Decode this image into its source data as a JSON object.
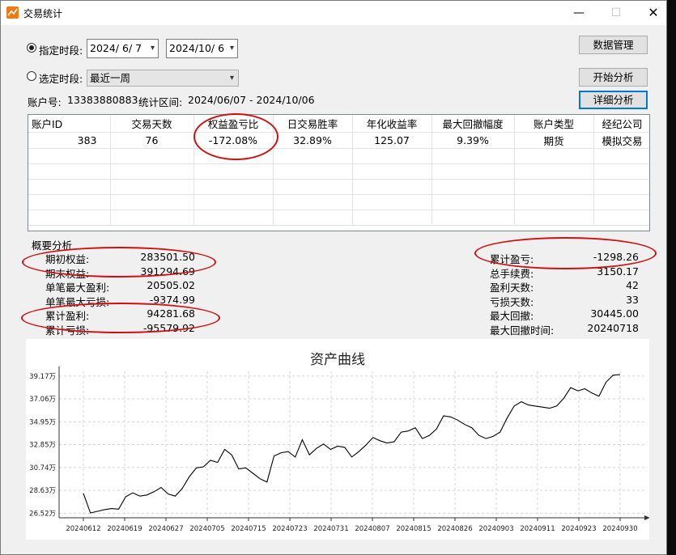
{
  "window": {
    "title": "交易统计",
    "controls": {
      "minimize": "—",
      "maximize": "☐",
      "close": "✕"
    }
  },
  "period": {
    "fixed_label": "指定时段:",
    "fixed_selected": true,
    "start_date": "2024/  6/  7",
    "end_date": "2024/10/  6",
    "preset_label": "选定时段:",
    "preset_selected": false,
    "preset_value": "最近一周"
  },
  "buttons": {
    "data_manage": "数据管理",
    "start_analysis": "开始分析",
    "detail_analysis": "详细分析"
  },
  "account_line": {
    "account_label": "账户号:",
    "account_no": "13383880883",
    "range_label": "统计区间:",
    "range_value": "2024/06/07 - 2024/10/06"
  },
  "table": {
    "columns": [
      "账户ID",
      "交易天数",
      "权益盈亏比",
      "日交易胜率",
      "年化收益率",
      "最大回撤幅度",
      "账户类型",
      "经纪公司"
    ],
    "rows": [
      [
        "383",
        "76",
        "-172.08%",
        "32.89%",
        "125.07",
        "9.39%",
        "期货",
        "模拟交易"
      ]
    ]
  },
  "summary": {
    "title": "概要分析",
    "left": [
      {
        "label": "期初权益:",
        "value": "283501.50"
      },
      {
        "label": "期末权益:",
        "value": "391294.69"
      },
      {
        "label": "单笔最大盈利:",
        "value": "20505.02"
      },
      {
        "label": "单笔最大亏损:",
        "value": "-9374.99"
      },
      {
        "label": "累计盈利:",
        "value": "94281.68"
      },
      {
        "label": "累计亏损:",
        "value": "-95579.92"
      }
    ],
    "right": [
      {
        "label": "累计盈亏:",
        "value": "-1298.26"
      },
      {
        "label": "总手续费:",
        "value": "3150.17"
      },
      {
        "label": "盈利天数:",
        "value": "42"
      },
      {
        "label": "亏损天数:",
        "value": "33"
      },
      {
        "label": "最大回撤:",
        "value": "30445.00"
      },
      {
        "label": "最大回撤时间:",
        "value": "20240718"
      }
    ]
  },
  "annotation_color": "#d01010",
  "chart_data": {
    "type": "line",
    "title": "资产曲线",
    "xlabel": "",
    "ylabel": "",
    "x_tick_labels": [
      "20240612",
      "20240619",
      "20240627",
      "20240705",
      "20240715",
      "20240723",
      "20240731",
      "20240807",
      "20240815",
      "20240826",
      "20240903",
      "20240911",
      "20240923",
      "20240930"
    ],
    "y_tick_labels": [
      "39.17万",
      "37.06万",
      "34.95万",
      "32.85万",
      "30.74万",
      "28.63万",
      "26.52万"
    ],
    "y_tick_values": [
      39.17,
      37.06,
      34.95,
      32.85,
      30.74,
      28.63,
      26.52
    ],
    "ylim": [
      26.1,
      39.6
    ],
    "grid": true,
    "series": [
      {
        "color": "#000000",
        "values": [
          28.35,
          26.55,
          26.7,
          26.85,
          26.95,
          26.9,
          28.05,
          28.4,
          28.1,
          28.2,
          28.5,
          28.9,
          28.3,
          28.1,
          28.8,
          29.9,
          30.7,
          30.8,
          31.4,
          31.2,
          32.4,
          31.9,
          30.6,
          30.7,
          30.2,
          29.7,
          29.4,
          31.8,
          32.1,
          32.2,
          31.7,
          33.3,
          31.9,
          32.5,
          32.9,
          32.4,
          32.7,
          32.6,
          31.7,
          32.2,
          32.8,
          33.5,
          33.2,
          33.0,
          33.1,
          34.0,
          34.1,
          34.4,
          33.4,
          33.7,
          34.3,
          35.5,
          35.4,
          35.1,
          34.7,
          34.4,
          33.7,
          33.4,
          33.6,
          34.0,
          35.3,
          36.4,
          36.8,
          36.5,
          36.4,
          36.3,
          36.2,
          36.4,
          37.1,
          38.1,
          37.8,
          38.0,
          37.6,
          37.3,
          38.6,
          39.25,
          39.3
        ]
      }
    ]
  }
}
